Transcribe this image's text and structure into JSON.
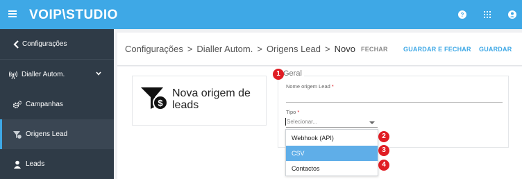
{
  "app": {
    "logo_text": "VOIP\\STUDIO"
  },
  "colors": {
    "brand": "#3ea8e6",
    "sidebar": "#2f3b47",
    "accent": "#3ea8e6",
    "badge": "#e01d24",
    "selected_option": "#5faee8"
  },
  "topbar": {
    "icons": [
      "help-icon",
      "apps-grid-icon",
      "user-icon"
    ]
  },
  "sidebar": {
    "items": [
      {
        "label": "Configurações",
        "icon": "chevron-left-icon"
      },
      {
        "label": "Dialler Autom.",
        "icon": "broadcast-icon",
        "expanded": true
      },
      {
        "label": "Campanhas",
        "icon": "gears-icon"
      },
      {
        "label": "Origens Lead",
        "icon": "funnel-dollar-icon",
        "active": true
      },
      {
        "label": "Leads",
        "icon": "user-icon"
      }
    ]
  },
  "header": {
    "breadcrumbs": [
      "Configurações",
      "Dialler Autom.",
      "Origens Lead",
      "Novo"
    ],
    "separator": ">",
    "buttons": {
      "close": "FECHAR",
      "save_close": "GUARDAR E FECHAR",
      "save": "GUARDAR"
    }
  },
  "card": {
    "title": "Nova origem de leads",
    "icon": "funnel-dollar-icon"
  },
  "form": {
    "legend": "Geral",
    "name_field": {
      "label": "Nome origem Lead",
      "required_mark": "*",
      "value": ""
    },
    "type_field": {
      "label": "Tipo",
      "required_mark": "*",
      "value": "Selecionar..."
    },
    "type_options": [
      "Webhook (API)",
      "CSV",
      "Contactos"
    ],
    "selected_option": "CSV"
  },
  "badges": [
    "1",
    "2",
    "3",
    "4"
  ]
}
